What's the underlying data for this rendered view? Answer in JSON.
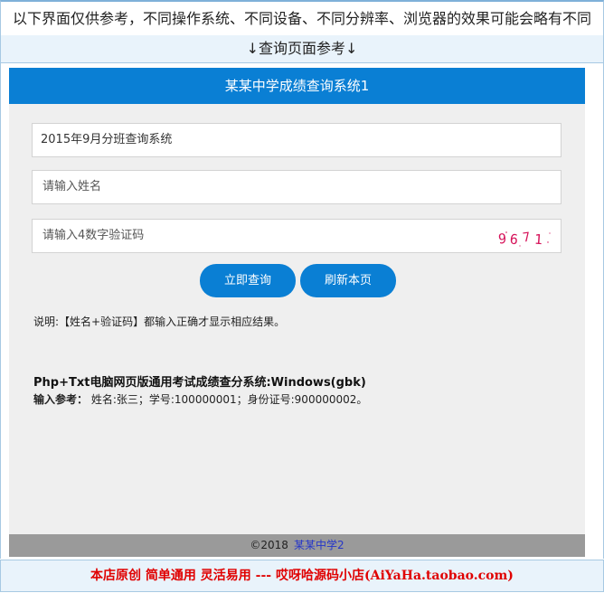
{
  "notice": {
    "text": "以下界面仅供参考，不同操作系统、不同设备、不同分辨率、浏览器的效果可能会略有不同",
    "sub": "↓查询页面参考↓"
  },
  "app": {
    "title": "某某中学成绩查询系统1",
    "exam_field_value": "2015年9月分班查询系统",
    "name_placeholder": "请输入姓名",
    "code_placeholder": "请输入4数字验证码",
    "captcha_text": "9671",
    "query_button": "立即查询",
    "refresh_button": "刷新本页",
    "description": "说明:【姓名+验证码】都输入正确才显示相应结果。",
    "system_title": "Php+Txt电脑网页版通用考试成绩查分系统:Windows(gbk)",
    "ref_label": "输入参考：",
    "ref_text": " 姓名:张三；学号:100000001；身份证号:900000002。"
  },
  "footer": {
    "copyright": "©2018",
    "link": "某某中学2"
  },
  "bottom_banner": "本店原创 简单通用 灵活易用 --- 哎呀哈源码小店(AiYaHa.taobao.com)",
  "colors": {
    "primary": "#0a7fd4",
    "panel_bg": "#efefef",
    "footer_bg": "#9a9a9a",
    "banner_text": "#e00000",
    "captcha": "#d6135a"
  }
}
